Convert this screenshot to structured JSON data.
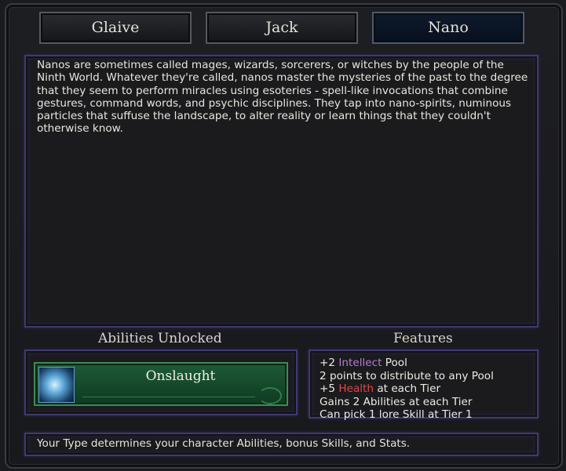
{
  "tabs": [
    {
      "label": "Glaive",
      "active": false
    },
    {
      "label": "Jack",
      "active": false
    },
    {
      "label": "Nano",
      "active": true
    }
  ],
  "description": "Nanos are sometimes called mages, wizards, sorcerers, or witches by the people of the Ninth World. Whatever they're called, nanos master the mysteries of the past to the degree that they seem to perform miracles using esoteries - spell-like invocations that combine gestures, command words, and psychic disciplines. They tap into nano-spirits, numinous particles that suffuse the landscape, to alter reality or learn things that they couldn't otherwise know.",
  "abilities": {
    "heading": "Abilities Unlocked",
    "items": [
      {
        "name": "Onslaught",
        "icon": "onslaught-icon"
      }
    ]
  },
  "features": {
    "heading": "Features",
    "lines": [
      {
        "prefix": "+2 ",
        "highlight": "Intellect",
        "suffix": " Pool",
        "highlight_color": "#b77ad8"
      },
      {
        "prefix": "2 points to distribute to any Pool",
        "highlight": "",
        "suffix": ""
      },
      {
        "prefix": "+5 ",
        "highlight": "Health",
        "suffix": " at each Tier",
        "highlight_color": "#e04848"
      },
      {
        "prefix": "Gains 2 Abilities at each Tier",
        "highlight": "",
        "suffix": ""
      },
      {
        "prefix": "Can pick 1 lore Skill at Tier 1",
        "highlight": "",
        "suffix": ""
      }
    ]
  },
  "footer": "Your Type determines your character Abilities, bonus Skills, and Stats.",
  "colors": {
    "accent_panel_border": "#3f3a6e",
    "ability_green": "#1e5a36"
  }
}
